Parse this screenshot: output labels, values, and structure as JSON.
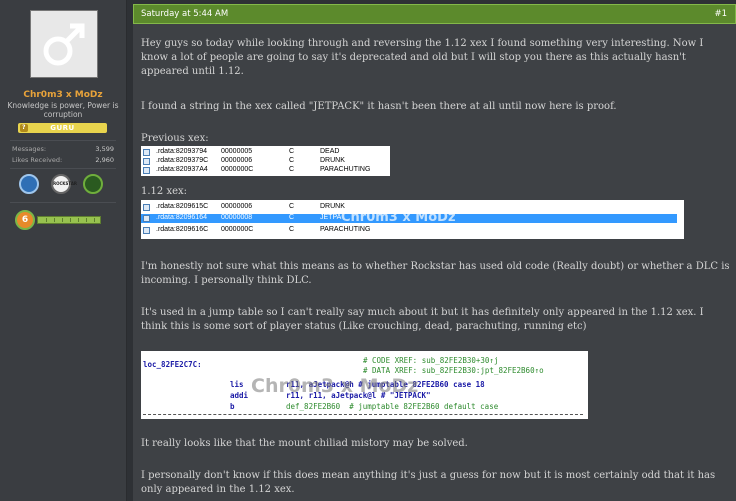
{
  "user": {
    "name": "Chr0m3 x MoDz",
    "tagline": "Knowledge is power, Power is corruption",
    "rank": "GURU",
    "stats": [
      {
        "label": "Messages:",
        "value": "3,599"
      },
      {
        "label": "Likes Received:",
        "value": "2,960"
      }
    ],
    "trophies": [
      "trophy-blue-icon",
      "trophy-rockstar-icon",
      "trophy-green-icon"
    ],
    "level": "6"
  },
  "post": {
    "date": "Saturday at 5:44 AM",
    "number": "#1",
    "p1": "Hey guys so today while looking through and reversing the 1.12 xex I found something very interesting. Now I know a lot of people are going to say it's deprecated and old but I will stop you there as this actually hasn't appeared until 1.12.",
    "p2": "I found a string in the xex called \"JETPACK\" it hasn't been there at all until now here is proof.",
    "prev_label": "Previous xex:",
    "new_label": "1.12 xex:",
    "prev_rows": [
      {
        "addr": ".rdata:82093794",
        "len": "00000005",
        "type": "C",
        "str": "DEAD"
      },
      {
        "addr": ".rdata:8209379C",
        "len": "00000006",
        "type": "C",
        "str": "DRUNK"
      },
      {
        "addr": ".rdata:820937A4",
        "len": "0000000C",
        "type": "C",
        "str": "PARACHUTING"
      }
    ],
    "new_rows": [
      {
        "addr": ".rdata:8209615C",
        "len": "00000006",
        "type": "C",
        "str": "DRUNK"
      },
      {
        "addr": ".rdata:82096164",
        "len": "00000008",
        "type": "C",
        "str": "JETPA"
      },
      {
        "addr": ".rdata:8209616C",
        "len": "0000000C",
        "type": "C",
        "str": "PARACHUTING"
      }
    ],
    "watermark": "Chr0m3 x MoDz",
    "p3": "I'm honestly not sure what this means as to whether Rockstar has used old code (Really doubt) or whether a DLC is incoming. I personally think DLC.",
    "p4": "It's used in a jump table so I can't really say much about it but it has definitely only appeared in the 1.12 xex. I think this is some sort of player status (Like crouching, dead, parachuting, running etc)",
    "code": {
      "label": "loc_82FE2C7C:",
      "xref": "# CODE XREF: sub_82FE2B30+30↑j",
      "data": "# DATA XREF: sub_82FE2B30:jpt_82FE2B60↑o",
      "l1_op": "lis",
      "l1_arg": "r11, aJetpack@h # jumptable 82FE2B60 case 18",
      "l2_op": "addi",
      "l2_arg": "r11, r11, aJetpack@l # \"JETPACK\"",
      "l3_op": "b",
      "l3_arg": "def_82FE2B60  # jumptable 82FE2B60 default case"
    },
    "p5": "It really looks like that the mount chiliad mistory may be solved.",
    "p6": "I personally don't know if this does mean anything it's just a guess for now but it is most certainly odd that it has only appeared in the 1.12 xex."
  },
  "colors": {
    "header": "#5c8a2c",
    "username": "#e8a33a",
    "rank": "#e8d44d",
    "highlight": "#3399ff"
  }
}
